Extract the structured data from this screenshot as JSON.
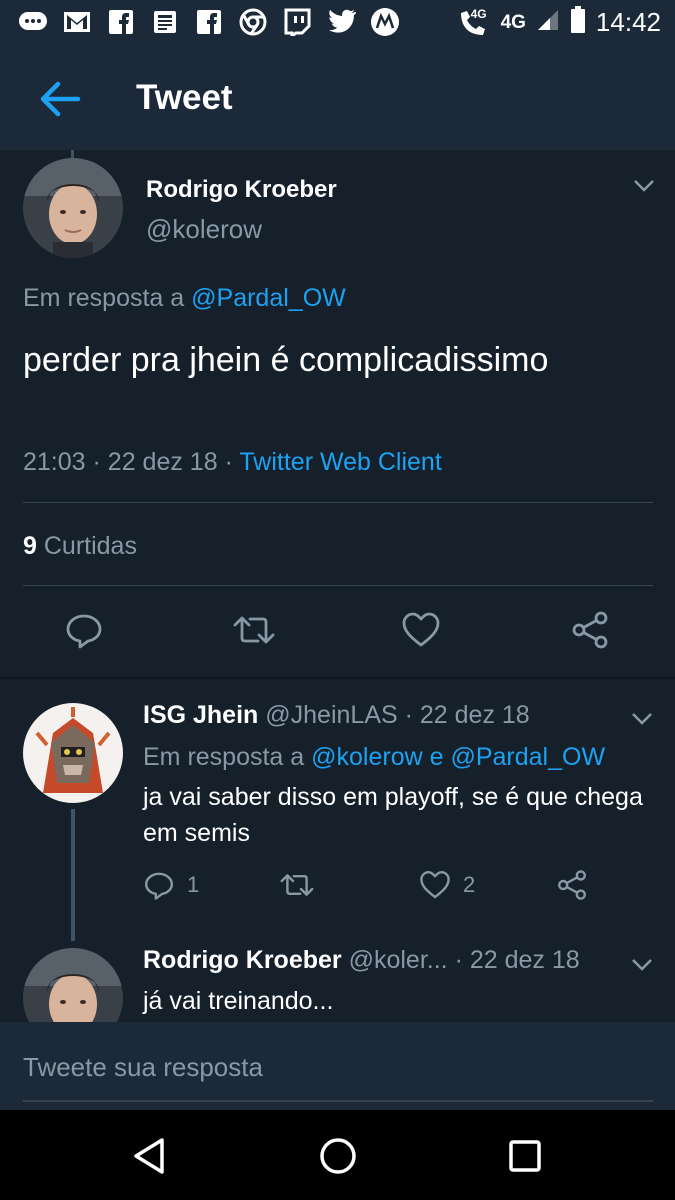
{
  "status_bar": {
    "time": "14:42",
    "network": "4G",
    "call_network": "4G",
    "icons": [
      "chat-icon",
      "gmail-icon",
      "facebook-icon",
      "news-icon",
      "facebook-icon",
      "chrome-icon",
      "twitch-icon",
      "twitter-icon",
      "motorola-icon",
      "wifi-call-icon",
      "signal-icon",
      "battery-icon"
    ]
  },
  "app_bar": {
    "title": "Tweet",
    "back_icon": "arrow-left-icon"
  },
  "main_tweet": {
    "author_name": "Rodrigo Kroeber",
    "author_handle": "@kolerow",
    "reply_prefix": "Em resposta a",
    "reply_to": "@Pardal_OW",
    "text": "perder pra jhein é complicadissimo",
    "time": "21:03",
    "date": "22 dez 18",
    "separator": "·",
    "source": "Twitter Web Client",
    "likes_count": "9",
    "likes_label": "Curtidas",
    "accent_color": "#1da1f2"
  },
  "replies": [
    {
      "author_name": "ISG Jhein",
      "author_handle": "@JheinLAS",
      "date": "· 22 dez 18",
      "reply_prefix": "Em resposta a",
      "reply_to": "@kolerow e @Pardal_OW",
      "text": "ja vai saber disso em playoff, se é que chega em semis",
      "reply_count": "1",
      "retweet_count": "",
      "like_count": "2"
    },
    {
      "author_name": "Rodrigo Kroeber",
      "author_handle": "@koler...",
      "date": "· 22 dez 18",
      "text": "já vai treinando..."
    }
  ],
  "compose": {
    "placeholder": "Tweete sua resposta"
  },
  "colors": {
    "background": "#15202b",
    "bar": "#1c2938",
    "accent": "#1da1f2",
    "muted": "#8899a6"
  }
}
